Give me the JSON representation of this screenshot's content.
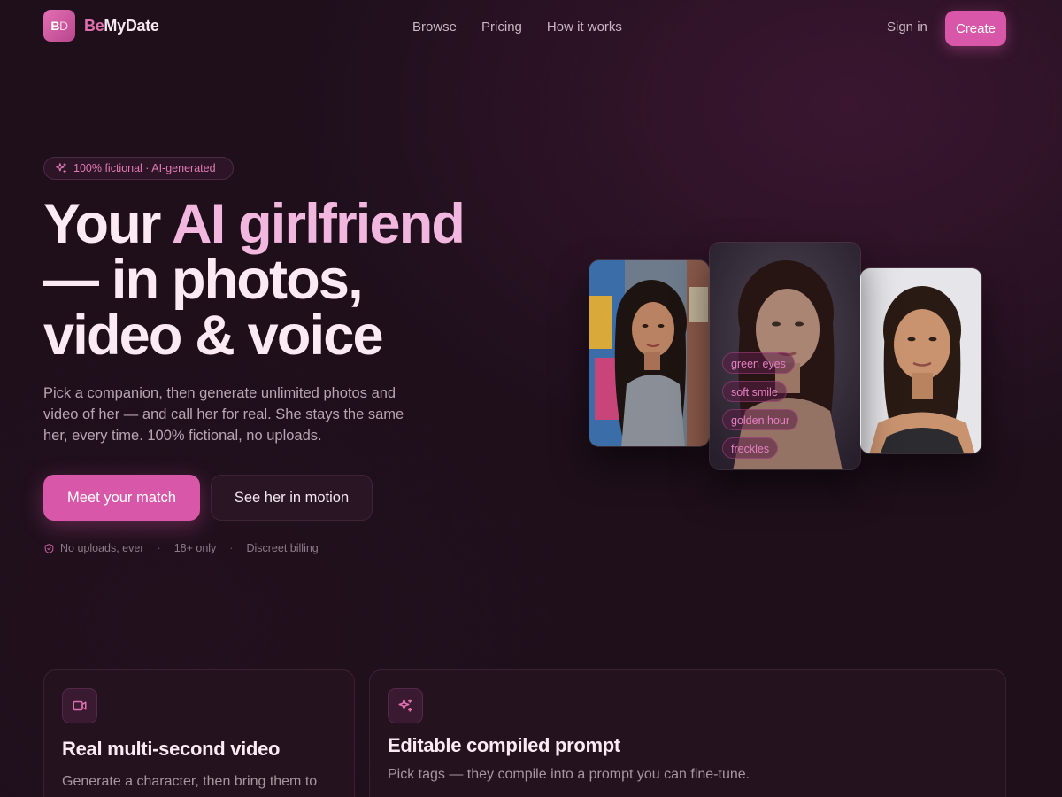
{
  "nav": {
    "logo_badge_b": "B",
    "logo_badge_d": "D",
    "logo_be": "Be",
    "logo_rest": "MyDate",
    "links": [
      "Browse",
      "Pricing",
      "How it works"
    ],
    "signin": "Sign in",
    "create": "Create"
  },
  "hero": {
    "pill": "100% fictional · AI-generated",
    "headline_1": "Your ",
    "headline_accent": "AI girlfriend",
    "headline_2": "— in photos,",
    "headline_3": "video & voice",
    "sub": "Pick a companion, then generate unlimited photos and video of her — and call her for real. She stays the same her, every time. 100% fictional, no uploads.",
    "cta_primary": "Meet your match",
    "cta_secondary": "See her in motion",
    "trust": [
      "No uploads, ever",
      "18+ only",
      "Discreet billing"
    ],
    "trust_sep": "·"
  },
  "tags": [
    "green eyes",
    "soft smile",
    "golden hour",
    "freckles"
  ],
  "features": [
    {
      "icon": "video-icon",
      "title": "Real multi-second video",
      "desc": "Generate a character, then bring them to"
    },
    {
      "icon": "sparkles-icon",
      "title": "Editable compiled prompt",
      "desc": "Pick tags — they compile into a prompt you can fine-tune."
    }
  ],
  "colors": {
    "accent": "#d957a8",
    "background": "#1e0f1b",
    "accent_text": "#f2b7de"
  }
}
